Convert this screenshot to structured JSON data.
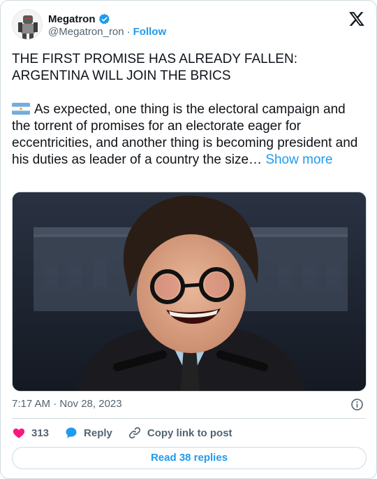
{
  "author": {
    "display_name": "Megatron",
    "handle": "@Megatron_ron",
    "separator": "·",
    "follow_label": "Follow"
  },
  "tweet": {
    "headline_line1": "THE FIRST PROMISE HAS ALREADY FALLEN:",
    "headline_line2": "ARGENTINA WILL JOIN THE BRICS",
    "body": "As expected, one thing is the electoral campaign and the torrent of promises for an electorate eager for eccentricities, and another thing is becoming president and his duties as leader of a country the size…",
    "show_more_label": "Show more",
    "flag_icon": "argentina-flag-icon"
  },
  "meta": {
    "timestamp": "7:17 AM · Nov 28, 2023"
  },
  "actions": {
    "like_count": "313",
    "reply_label": "Reply",
    "copy_label": "Copy link to post"
  },
  "footer": {
    "read_replies_label": "Read 38 replies"
  },
  "colors": {
    "accent": "#1d9bf0",
    "like": "#f91880",
    "text": "#0f1419",
    "muted": "#536471",
    "border": "#cfd9de"
  }
}
